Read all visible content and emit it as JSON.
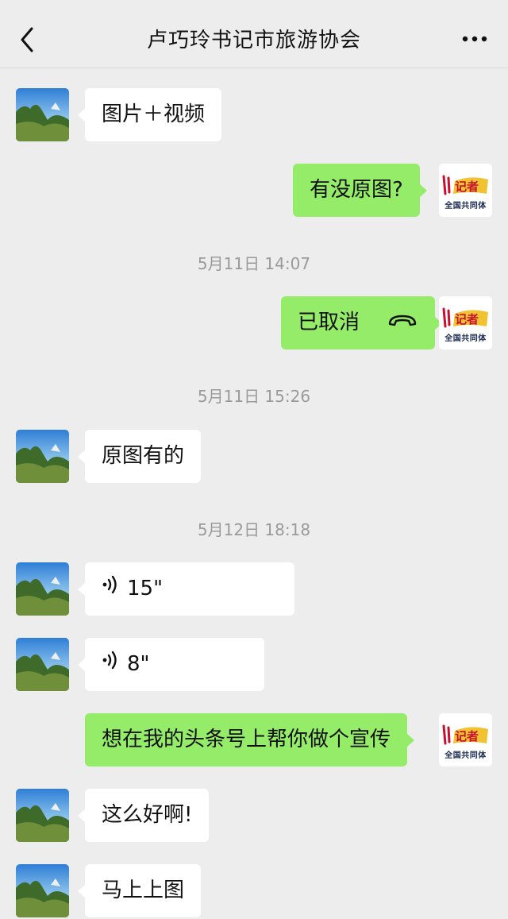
{
  "header": {
    "title": "卢巧玲书记市旅游协会",
    "back_icon": "chevron-left-icon",
    "more_icon": "ellipsis-icon"
  },
  "self_avatar": {
    "logo_label": "全国共同体",
    "icon": "newspaper-reporter-logo"
  },
  "contact_avatar": {
    "icon": "landscape-photo-avatar"
  },
  "messages": [
    {
      "side": "in",
      "text": "图片＋视频"
    },
    {
      "side": "out",
      "text": "有没原图?"
    },
    {
      "type": "time",
      "text": "5月11日 14:07"
    },
    {
      "side": "out",
      "text": "已取消",
      "kind": "call",
      "icon": "phone-hangup-icon"
    },
    {
      "type": "time",
      "text": "5月11日 15:26"
    },
    {
      "side": "in",
      "text": "原图有的"
    },
    {
      "type": "time",
      "text": "5月12日 18:18"
    },
    {
      "side": "in",
      "kind": "voice",
      "text": "15\"",
      "icon": "voice-icon"
    },
    {
      "side": "in",
      "kind": "voice",
      "text": "8\"",
      "icon": "voice-icon"
    },
    {
      "side": "out",
      "text": "想在我的头条号上帮你做个宣传"
    },
    {
      "side": "in",
      "text": "这么好啊!"
    },
    {
      "side": "in",
      "text": "马上上图"
    }
  ],
  "colors": {
    "outgoing": "#95ec69",
    "incoming": "#ffffff",
    "background": "#ededed"
  }
}
